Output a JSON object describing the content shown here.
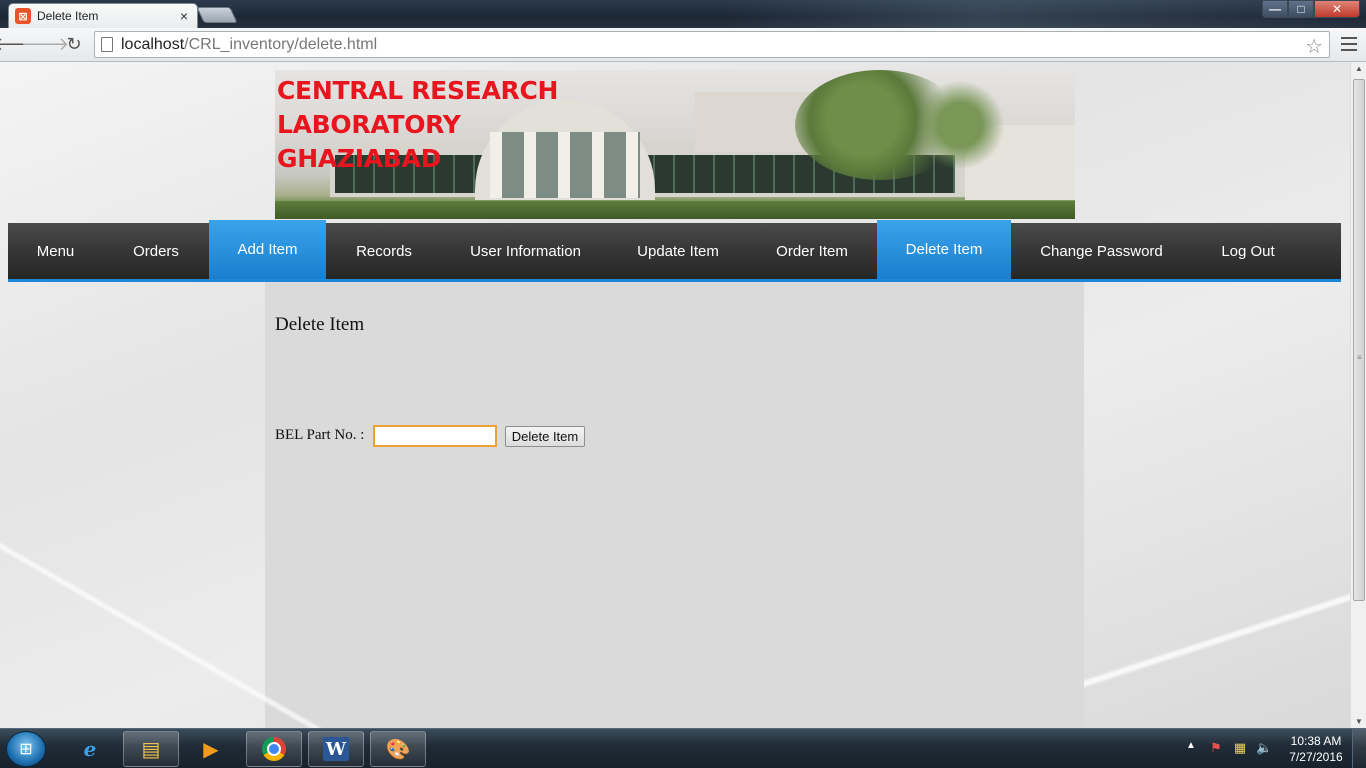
{
  "browser": {
    "tab_title": "Delete Item",
    "tab_close": "×",
    "url_host": "localhost",
    "url_path": "/CRL_inventory/delete.html",
    "window_controls": {
      "minimize": "—",
      "maximize": "□",
      "close": "✕"
    }
  },
  "banner": {
    "line1": "CENTRAL RESEARCH LABORATORY",
    "line2": "GHAZIABAD",
    "title_color": "#e8141e"
  },
  "nav": {
    "accent_color": "#1e88d8",
    "items": [
      {
        "label": "Menu",
        "active": false
      },
      {
        "label": "Orders",
        "active": false
      },
      {
        "label": "Add Item",
        "active": true
      },
      {
        "label": "Records",
        "active": false
      },
      {
        "label": "User Information",
        "active": false
      },
      {
        "label": "Update Item",
        "active": false
      },
      {
        "label": "Order Item",
        "active": false
      },
      {
        "label": "Delete Item",
        "active": true
      },
      {
        "label": "Change Password",
        "active": false
      },
      {
        "label": "Log Out",
        "active": false
      }
    ]
  },
  "page": {
    "heading": "Delete Item",
    "form": {
      "label": "BEL Part No. :",
      "input_value": "",
      "button_label": "Delete Item"
    }
  },
  "taskbar": {
    "apps": [
      "internet-explorer",
      "windows-explorer",
      "media-player",
      "google-chrome",
      "microsoft-word",
      "paint"
    ],
    "time": "10:38 AM",
    "date": "7/27/2016"
  }
}
